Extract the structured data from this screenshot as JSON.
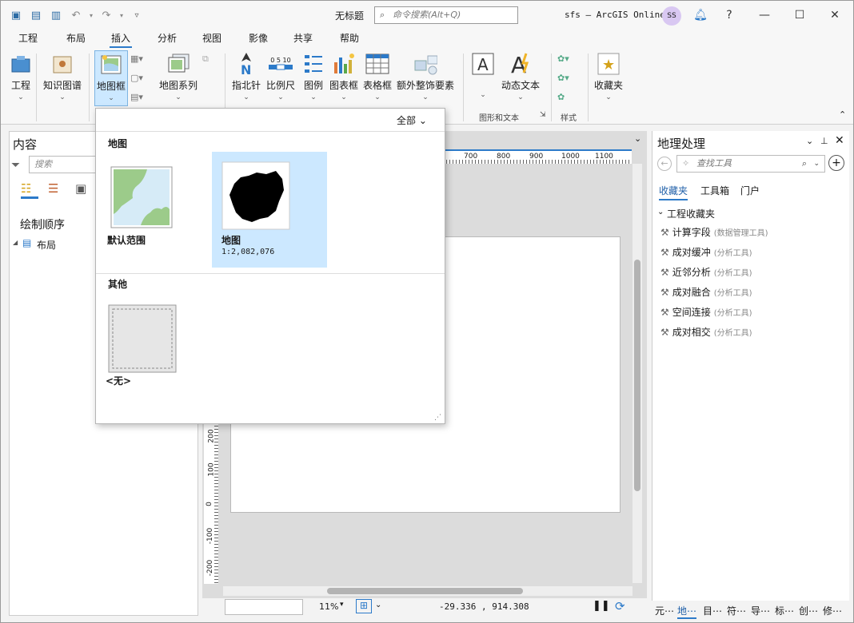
{
  "window": {
    "doc_title": "无标题",
    "search_placeholder": "命令搜索(Alt+Q)",
    "account": "sfs – ArcGIS Online",
    "avatar": "SS",
    "help": "?"
  },
  "tabs": [
    "工程",
    "布局",
    "插入",
    "分析",
    "视图",
    "影像",
    "共享",
    "帮助"
  ],
  "active_tab": "插入",
  "ribbon": {
    "project": "工程",
    "knowledge_graph": "知识图谱",
    "map_frame": "地图框",
    "map_series": "地图系列",
    "north_arrow": "指北针",
    "scale_bar": "比例尺",
    "legend": "图例",
    "chart_frame": "图表框",
    "table_frame": "表格框",
    "extra_surround": "额外整饰要素",
    "dynamic_text": "动态文本",
    "group_graphics_text": "图形和文本",
    "group_styles": "样式",
    "favorites": "收藏夹",
    "scale_ticks": "0 5 10"
  },
  "contents": {
    "title": "内容",
    "search_placeholder": "搜索",
    "drawing_order": "绘制顺序",
    "layout_item": "布局"
  },
  "dropdown": {
    "filter": "全部",
    "section_map": "地图",
    "default_extent": "默认范围",
    "map_item_label": "地图",
    "map_item_scale": "1:2,082,076",
    "section_other": "其他",
    "none_label": "<无>"
  },
  "ruler": {
    "h": [
      "700",
      "800",
      "900",
      "1000",
      "1100"
    ],
    "v": [
      "200",
      "100",
      "0",
      "-100",
      "-200"
    ]
  },
  "status": {
    "zoom": "11%",
    "coords": "-29.336 , 914.308"
  },
  "geoprocessing": {
    "title": "地理处理",
    "search_placeholder": "查找工具",
    "tabs": [
      "收藏夹",
      "工具箱",
      "门户"
    ],
    "group": "工程收藏夹",
    "tools": [
      {
        "name": "计算字段",
        "toolbox": "(数据管理工具)"
      },
      {
        "name": "成对缓冲",
        "toolbox": "(分析工具)"
      },
      {
        "name": "近邻分析",
        "toolbox": "(分析工具)"
      },
      {
        "name": "成对融合",
        "toolbox": "(分析工具)"
      },
      {
        "name": "空间连接",
        "toolbox": "(分析工具)"
      },
      {
        "name": "成对相交",
        "toolbox": "(分析工具)"
      }
    ]
  },
  "bottom_tabs": [
    "元⋯",
    "地⋯",
    "目⋯",
    "符⋯",
    "导⋯",
    "标⋯",
    "创⋯",
    "修⋯"
  ],
  "colors": {
    "accent": "#2c7ac9",
    "selected_bg": "#cce8ff",
    "favorite_tab": "#1f5fa8"
  }
}
